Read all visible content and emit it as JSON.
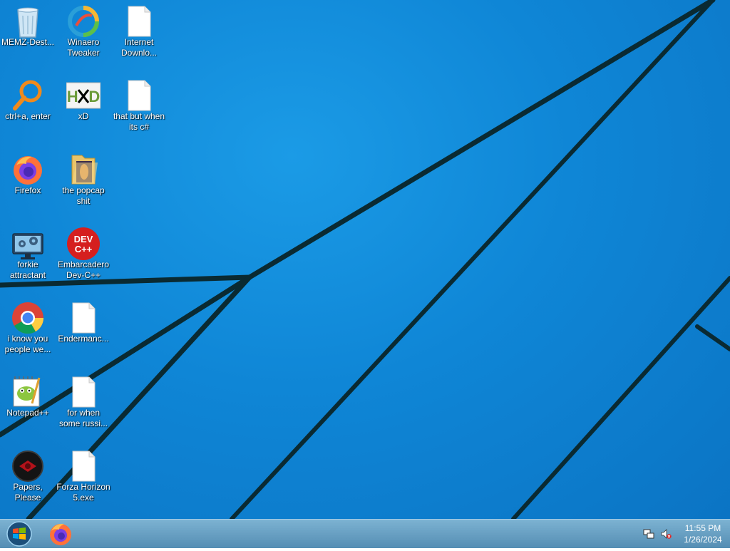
{
  "desktop": {
    "icons": [
      {
        "label": "MEMZ-Dest...",
        "icon": "recycle-bin-icon"
      },
      {
        "label": "Winaero Tweaker",
        "icon": "winaero-icon"
      },
      {
        "label": "Internet Downlo...",
        "icon": "blank-file-icon"
      },
      {
        "label": "ctrl+a, enter",
        "icon": "magnifier-icon"
      },
      {
        "label": "xD",
        "icon": "hxd-icon"
      },
      {
        "label": "that but when its c#",
        "icon": "blank-file-icon"
      },
      {
        "label": "Firefox",
        "icon": "firefox-icon"
      },
      {
        "label": "the popcap shit",
        "icon": "folder-icon"
      },
      {
        "label": "forkie attractant",
        "icon": "settings-monitor-icon"
      },
      {
        "label": "Embarcadero Dev-C++",
        "icon": "devcpp-icon"
      },
      {
        "label": "i know you people we...",
        "icon": "chrome-icon"
      },
      {
        "label": "Endermanc...",
        "icon": "blank-file-icon"
      },
      {
        "label": "Notepad++",
        "icon": "notepadpp-icon"
      },
      {
        "label": "for when some russi...",
        "icon": "blank-file-icon"
      },
      {
        "label": "Papers, Please",
        "icon": "papers-please-icon"
      },
      {
        "label": "Forza Horizon 5.exe",
        "icon": "blank-file-icon"
      }
    ],
    "devcpp_text": [
      "DEV",
      "C++"
    ],
    "hxd_text": "HXD"
  },
  "taskbar": {
    "start": "start-orb-icon",
    "pinned": [
      "firefox-icon"
    ],
    "tray": {
      "icons": [
        "network-icon",
        "volume-muted-icon"
      ],
      "time": "11:55 PM",
      "date": "1/26/2024"
    }
  },
  "colors": {
    "wallpaper": "#0f86d6",
    "taskbar": "#5a9cc4",
    "devcpp": "#d51f1f",
    "firefox": "#ff7139"
  }
}
